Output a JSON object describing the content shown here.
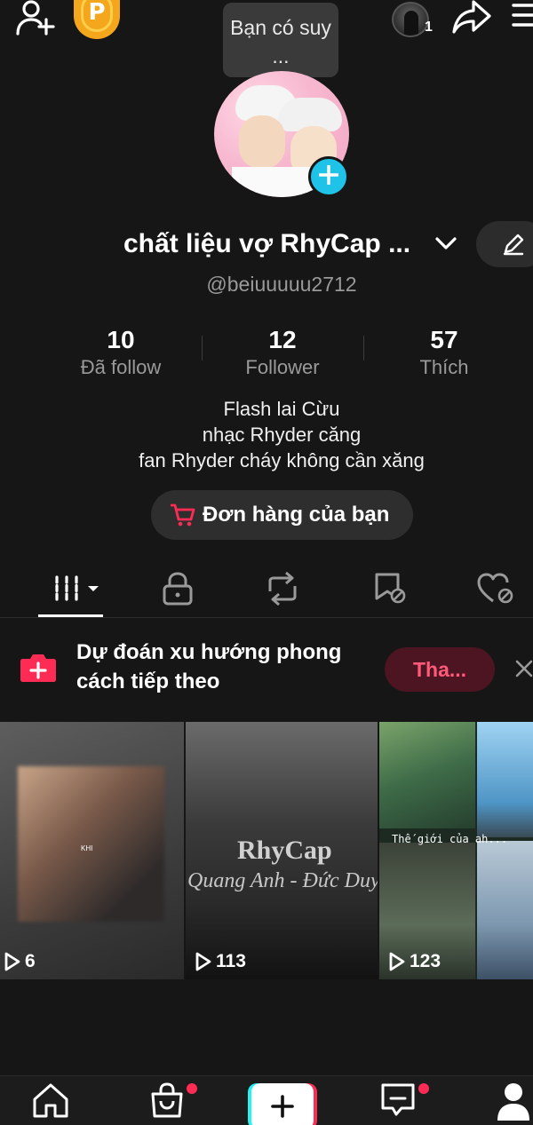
{
  "colors": {
    "background": "#161616",
    "accent_cyan": "#20c3e8",
    "accent_red": "#fe2c55",
    "coin": "#f4a71d"
  },
  "topbar": {
    "icons": [
      "add-friend-icon",
      "coin-icon",
      "share-icon",
      "menu-icon"
    ],
    "coin_letter": "P",
    "account_count": "1"
  },
  "tooltip": {
    "text": "Bạn có suy ..."
  },
  "profile": {
    "name": "chất liệu vợ RhyCap ...",
    "username": "@beiuuuuu2712",
    "stats": [
      {
        "value": "10",
        "label": "Đã follow"
      },
      {
        "value": "12",
        "label": "Follower"
      },
      {
        "value": "57",
        "label": "Thích"
      }
    ],
    "bio": [
      "Flash lai Cừu",
      "nhạc Rhyder căng",
      "fan Rhyder cháy không cần xăng"
    ],
    "orders_button": "Đơn hàng của bạn"
  },
  "tabs": {
    "icons": [
      "grid-icon",
      "lock-icon",
      "repost-icon",
      "hidden-tag-icon",
      "liked-hidden-icon"
    ],
    "active_index": 0
  },
  "banner": {
    "text": "Dự đoán xu hướng phong cách tiếp theo",
    "cta": "Tha..."
  },
  "videos": [
    {
      "views": "6",
      "caption": "KHI"
    },
    {
      "views": "113",
      "watermark_title": "RhyCap",
      "watermark_subtitle": "Quang Anh - Đức Duy"
    },
    {
      "views": "123",
      "caption": "Thế giới của ah..."
    }
  ],
  "bottom_nav": {
    "items": [
      "home-icon",
      "shop-icon",
      "create-icon",
      "inbox-icon",
      "profile-icon"
    ]
  }
}
